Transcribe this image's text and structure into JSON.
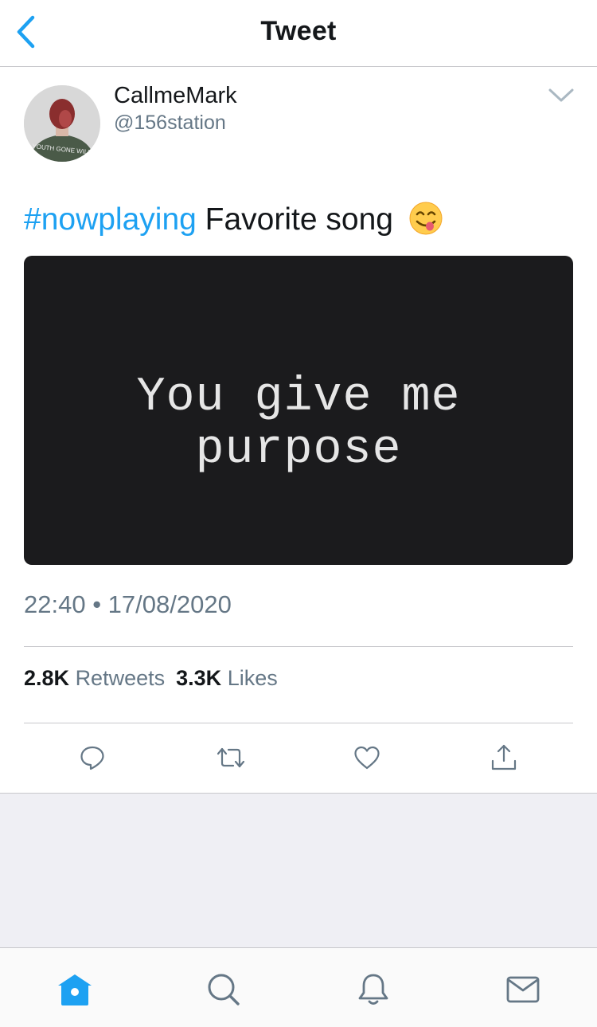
{
  "navbar": {
    "title": "Tweet"
  },
  "tweet": {
    "display_name": "CallmeMark",
    "handle": "@156station",
    "avatar_shirt_text": "YOUTH GONE WILD",
    "hashtag": "#nowplaying",
    "text": "Favorite song",
    "emoji": "face-savoring-food",
    "media_caption_line1": "You give me",
    "media_caption_line2": "purpose",
    "timestamp": "22:40 • 17/08/2020",
    "retweets_count": "2.8K",
    "retweets_label": "Retweets",
    "likes_count": "3.3K",
    "likes_label": "Likes"
  },
  "actions": [
    "reply-icon",
    "retweet-icon",
    "like-icon",
    "share-icon"
  ],
  "tabbar": {
    "items": [
      "home-icon",
      "search-icon",
      "notifications-icon",
      "messages-icon"
    ],
    "active": "home-icon"
  },
  "colors": {
    "accent": "#1da1f2",
    "secondary_text": "#657786",
    "primary_text": "#14171a",
    "divider": "#c8c8cc",
    "background_gray": "#efeff4"
  }
}
